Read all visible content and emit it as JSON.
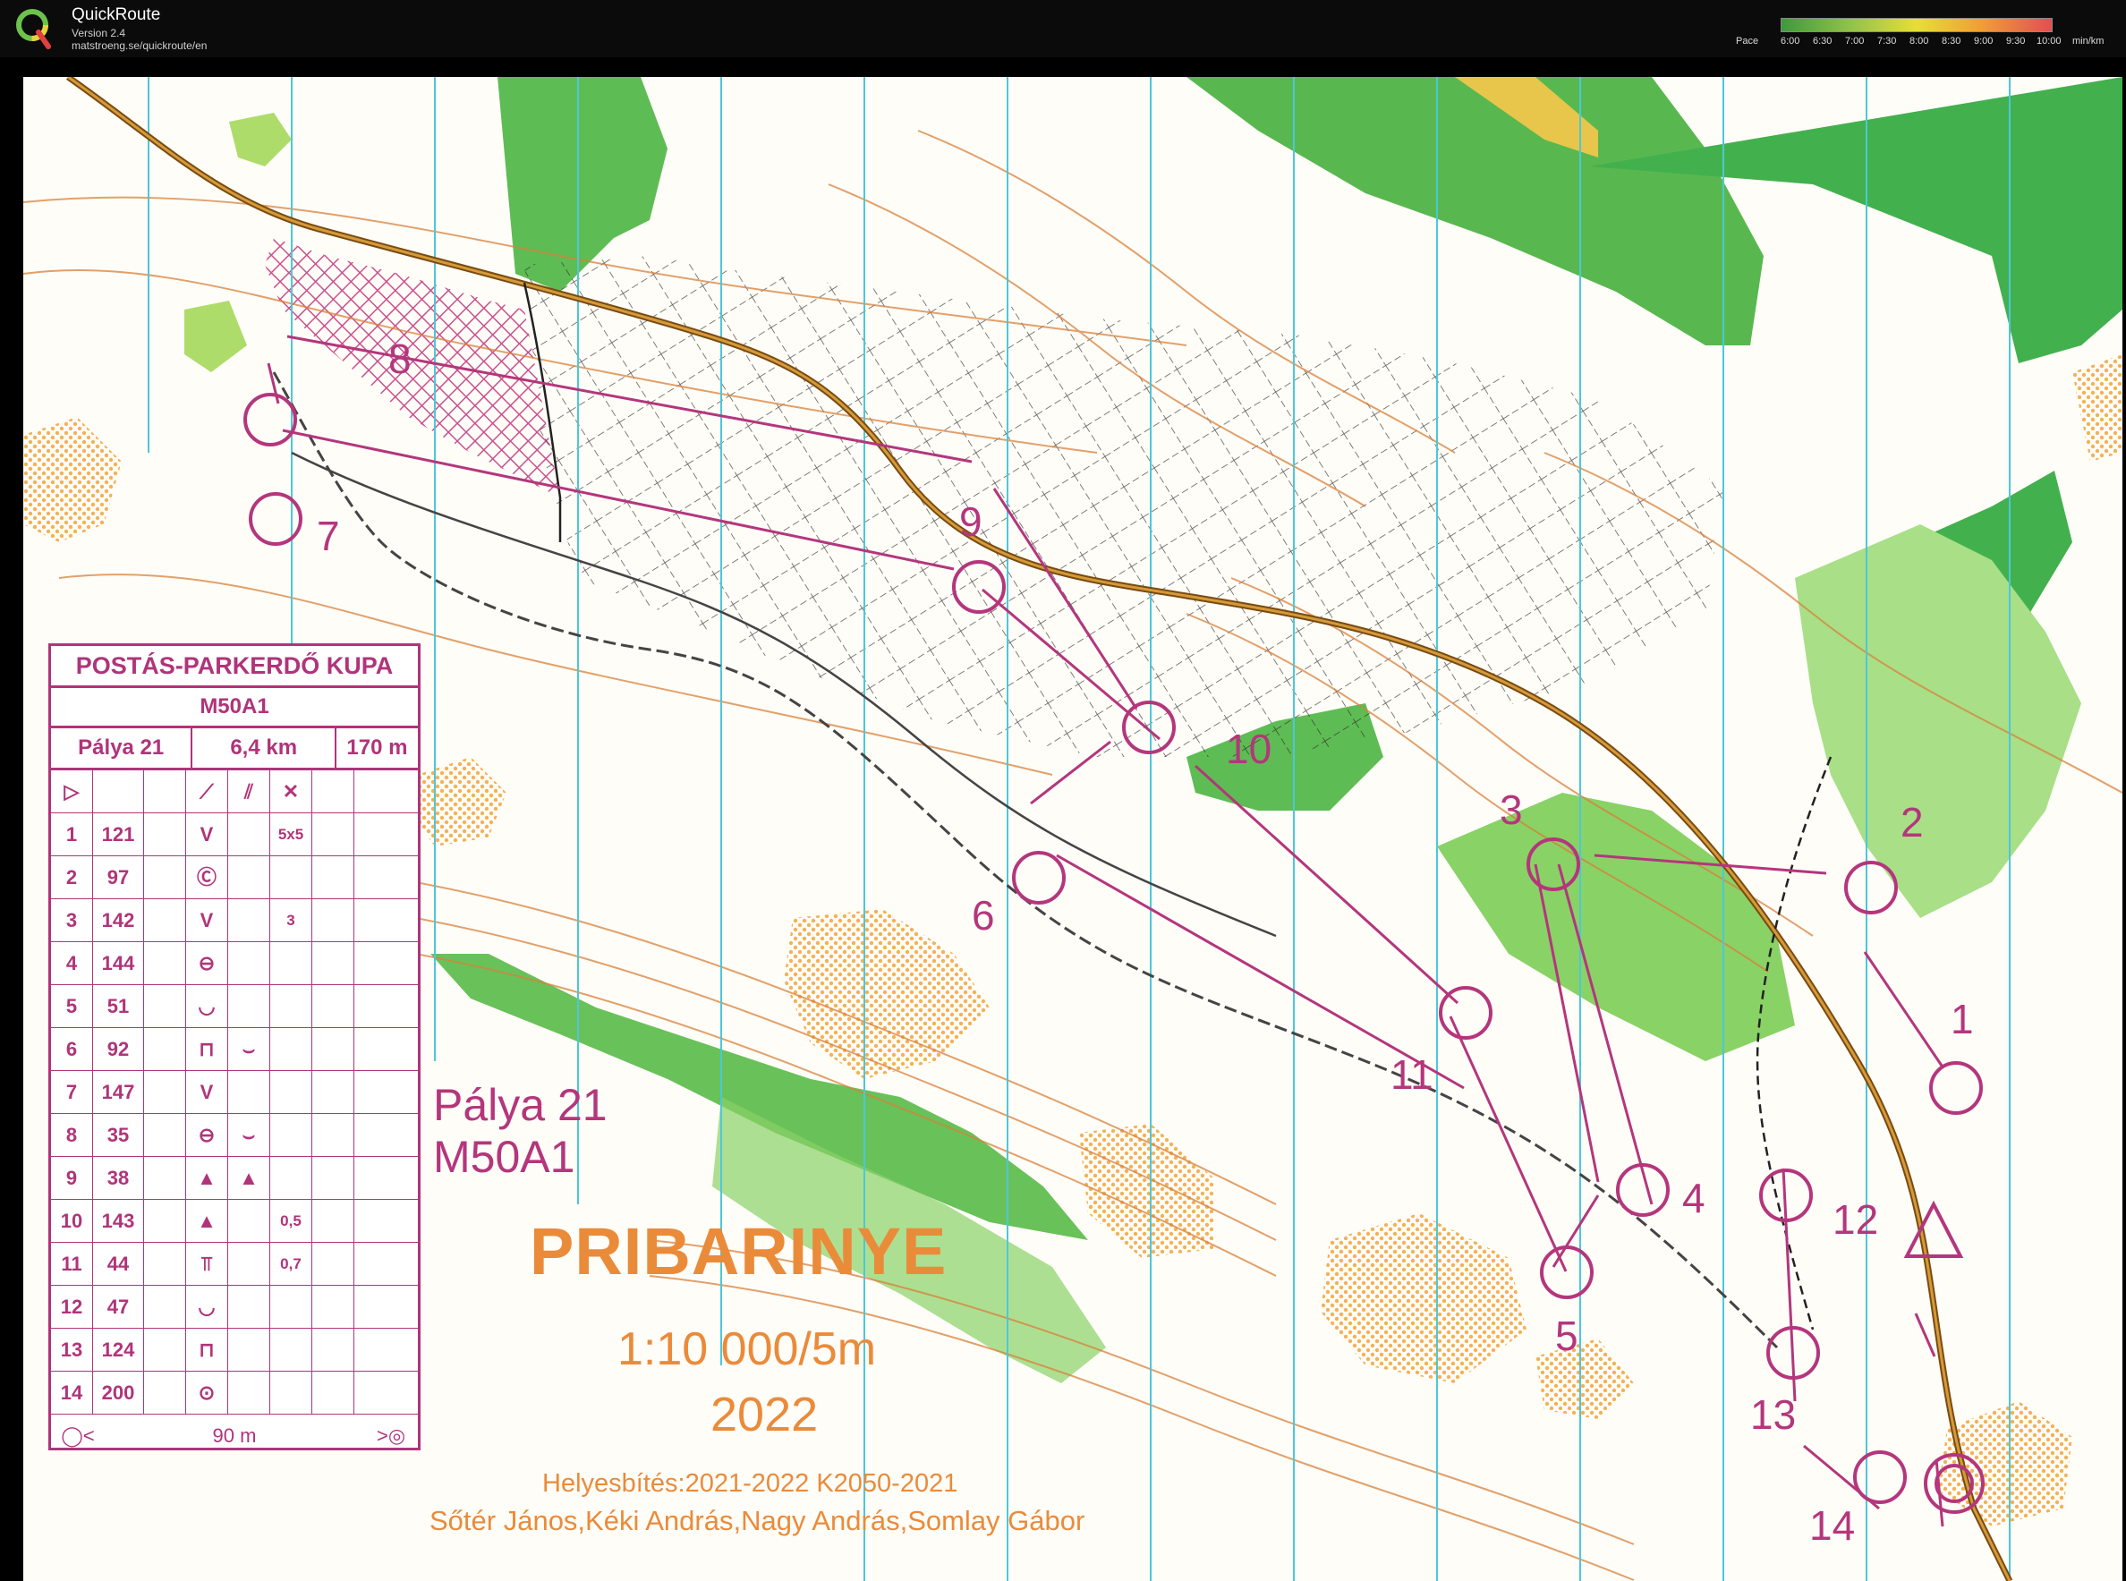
{
  "app": {
    "title": "QuickRoute",
    "version": "Version 2.4",
    "url": "matstroeng.se/quickroute/en",
    "pace_label": "Pace",
    "pace_ticks": [
      "6:00",
      "6:30",
      "7:00",
      "7:30",
      "8:00",
      "8:30",
      "9:00",
      "9:30",
      "10:00"
    ],
    "pace_unit": "min/km",
    "pace_colors": [
      "#3e9a3a",
      "#8fc24a",
      "#e8dd3c",
      "#f19a38",
      "#e05050"
    ]
  },
  "legend": {
    "title": "POSTÁS-PARKERDŐ KUPA",
    "class": "M50A1",
    "course": "Pálya 21",
    "length": "6,4 km",
    "climb": "170 m",
    "controls": [
      {
        "n": "1",
        "code": "121",
        "d": "V",
        "extra": "",
        "x": "5x5"
      },
      {
        "n": "2",
        "code": "97",
        "d": "Ⓒ",
        "extra": "",
        "x": ""
      },
      {
        "n": "3",
        "code": "142",
        "d": "V",
        "extra": "",
        "x": "3"
      },
      {
        "n": "4",
        "code": "144",
        "d": "⊖",
        "extra": "",
        "x": ""
      },
      {
        "n": "5",
        "code": "51",
        "d": "◡",
        "extra": "",
        "x": ""
      },
      {
        "n": "6",
        "code": "92",
        "d": "⊓",
        "extra": "⌣",
        "x": ""
      },
      {
        "n": "7",
        "code": "147",
        "d": "V",
        "extra": "",
        "x": ""
      },
      {
        "n": "8",
        "code": "35",
        "d": "⊖",
        "extra": "⌣",
        "x": ""
      },
      {
        "n": "9",
        "code": "38",
        "d": "▲",
        "extra": "▲",
        "x": ""
      },
      {
        "n": "10",
        "code": "143",
        "d": "▲",
        "extra": "",
        "x": "0,5"
      },
      {
        "n": "11",
        "code": "44",
        "d": "⫪",
        "extra": "",
        "x": "0,7"
      },
      {
        "n": "12",
        "code": "47",
        "d": "◡",
        "extra": "",
        "x": ""
      },
      {
        "n": "13",
        "code": "124",
        "d": "⊓",
        "extra": "",
        "x": ""
      },
      {
        "n": "14",
        "code": "200",
        "d": "⊙",
        "extra": "",
        "x": ""
      }
    ],
    "finish": "90 m"
  },
  "map_text": {
    "course_name": "Pálya 21",
    "course_class": "M50A1",
    "map_name": "PRIBARINYE",
    "scale": "1:10 000/5m",
    "year": "2022",
    "revision": "Helyesbítés:2021-2022  K2050-2021",
    "authors": "Sőtér János,Kéki András,Nagy András,Somlay Gábor"
  },
  "control_labels": [
    "1",
    "2",
    "3",
    "4",
    "5",
    "6",
    "7",
    "8",
    "9",
    "10",
    "11",
    "12",
    "13",
    "14"
  ]
}
